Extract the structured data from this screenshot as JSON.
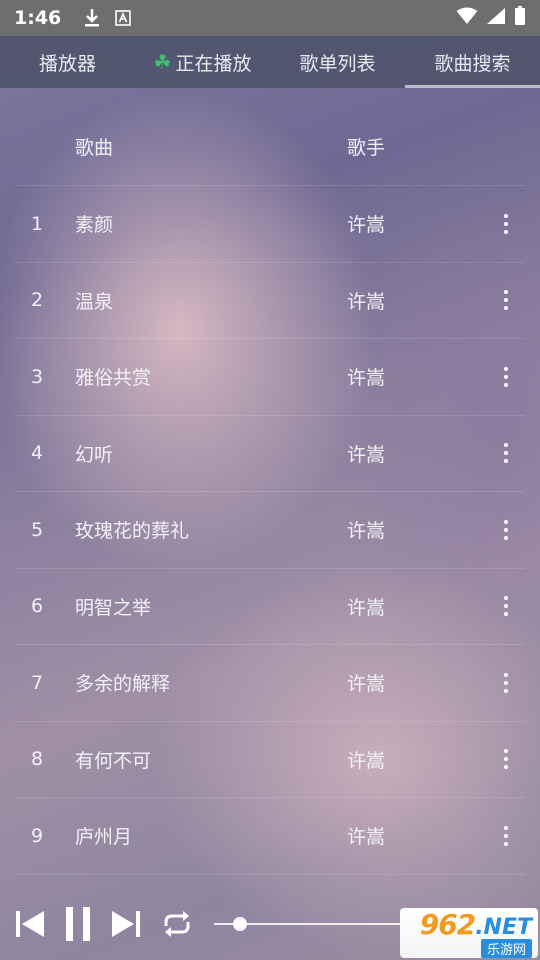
{
  "status": {
    "time": "1:46"
  },
  "tabs": [
    {
      "label": "播放器"
    },
    {
      "label": "正在播放",
      "icon": "clover-icon"
    },
    {
      "label": "歌单列表"
    },
    {
      "label": "歌曲搜索",
      "active": true
    }
  ],
  "table": {
    "headers": {
      "title": "歌曲",
      "artist": "歌手"
    },
    "rows": [
      {
        "num": "1",
        "title": "素颜",
        "artist": "许嵩"
      },
      {
        "num": "2",
        "title": "温泉",
        "artist": "许嵩"
      },
      {
        "num": "3",
        "title": "雅俗共赏",
        "artist": "许嵩"
      },
      {
        "num": "4",
        "title": "幻听",
        "artist": "许嵩"
      },
      {
        "num": "5",
        "title": "玫瑰花的葬礼",
        "artist": "许嵩"
      },
      {
        "num": "6",
        "title": "明智之举",
        "artist": "许嵩"
      },
      {
        "num": "7",
        "title": "多余的解释",
        "artist": "许嵩"
      },
      {
        "num": "8",
        "title": "有何不可",
        "artist": "许嵩"
      },
      {
        "num": "9",
        "title": "庐州月",
        "artist": "许嵩"
      }
    ]
  },
  "player": {
    "progress": 0.1
  },
  "watermark": {
    "number": "962",
    "suffix": ".NET",
    "subtitle": "乐游网"
  }
}
